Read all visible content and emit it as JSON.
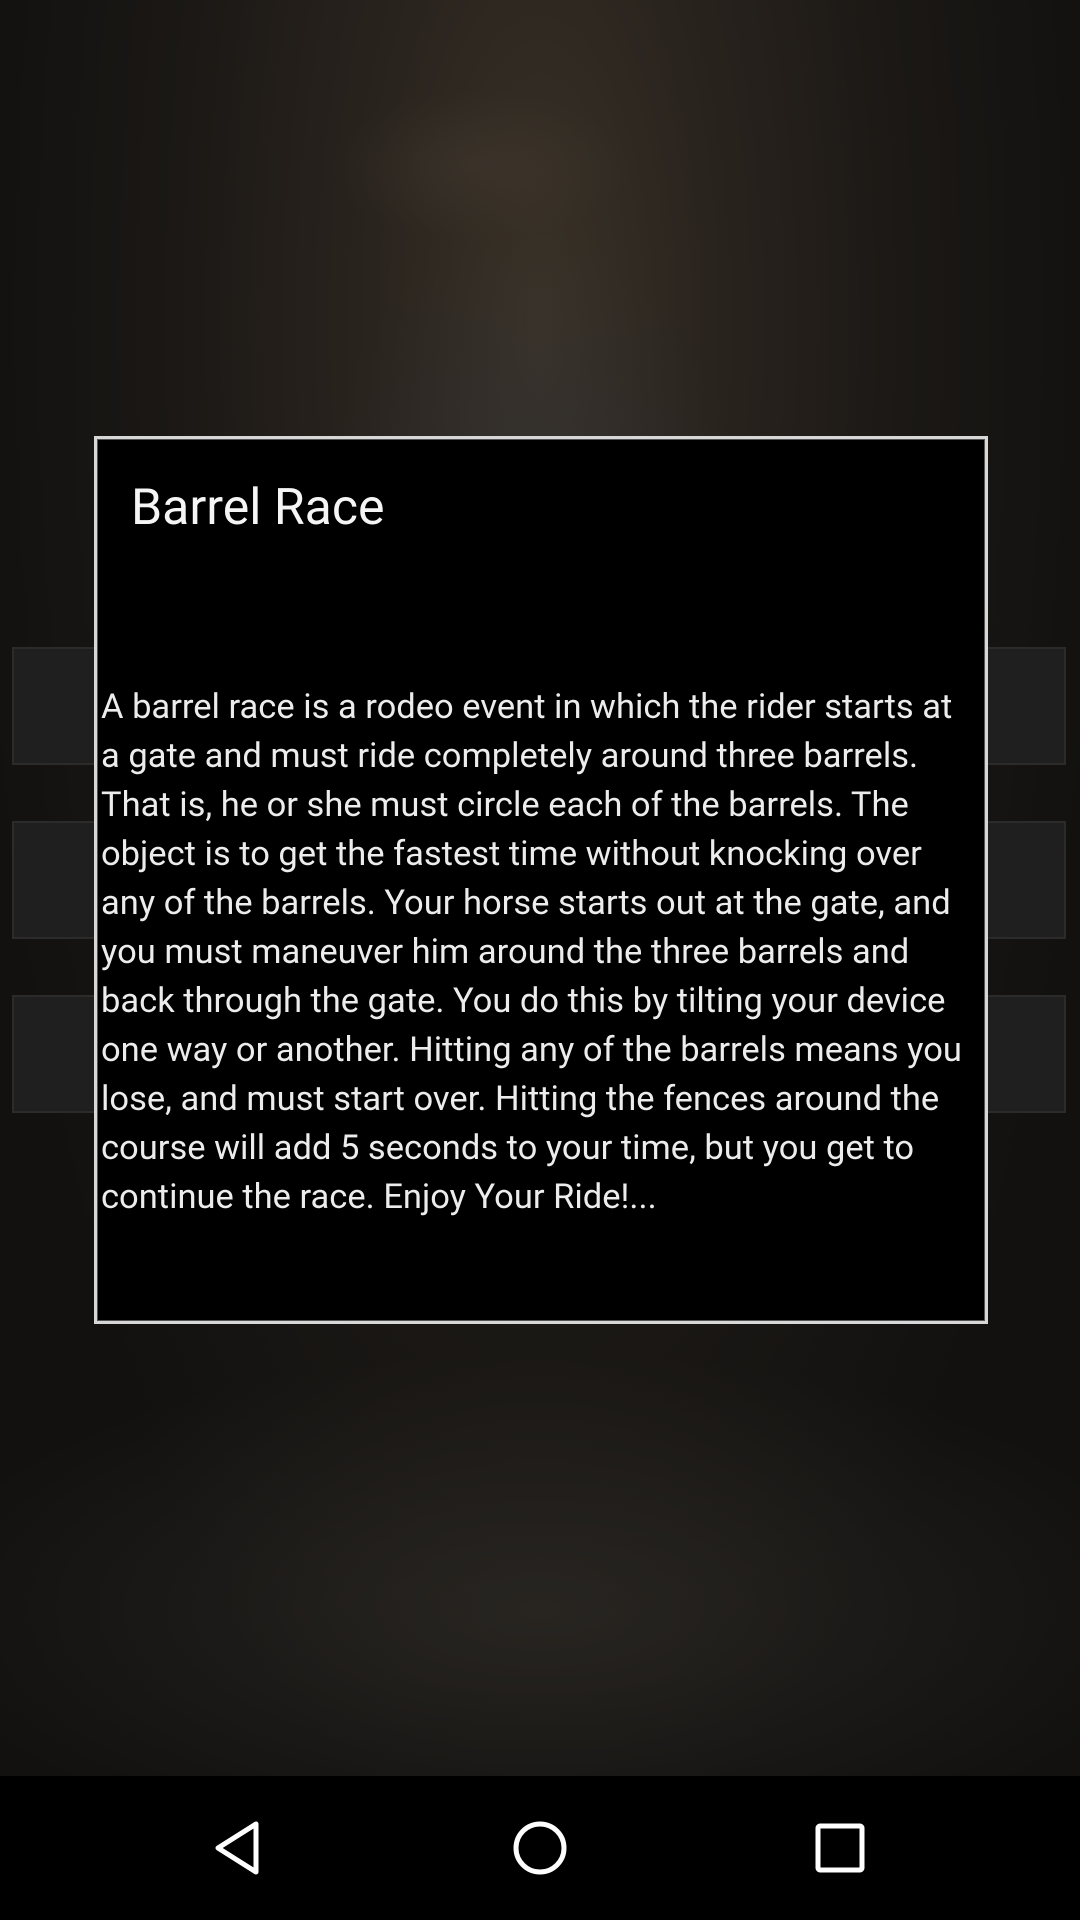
{
  "dialog": {
    "title": "Barrel Race",
    "message": "A barrel race is a rodeo event in which the rider starts at a gate and must ride completely around three barrels. That is, he or she must circle each of the barrels. The object is to get the fastest time without knocking over any of the barrels. Your horse starts out at the gate, and you must maneuver him around the three barrels and back through the gate. You do this by tilting your device one way or another. Hitting any of the barrels means you lose, and must start over. Hitting the fences around the course will add 5 seconds to your time, but you get to continue the race. Enjoy Your Ride!..."
  },
  "background_menu": {
    "buttons": [
      {
        "icon": "",
        "label": ""
      },
      {
        "icon": "",
        "label": ""
      },
      {
        "icon": "",
        "label": ""
      }
    ]
  },
  "nav_bar": {
    "back_icon": "back-triangle-icon",
    "home_icon": "home-circle-icon",
    "recents_icon": "recents-square-icon",
    "icon_color": "#ffffff"
  },
  "colors": {
    "dialog_background": "#000000",
    "dialog_border": "#d7d7d7",
    "text": "#ececec",
    "scrim_background": "#151311"
  }
}
